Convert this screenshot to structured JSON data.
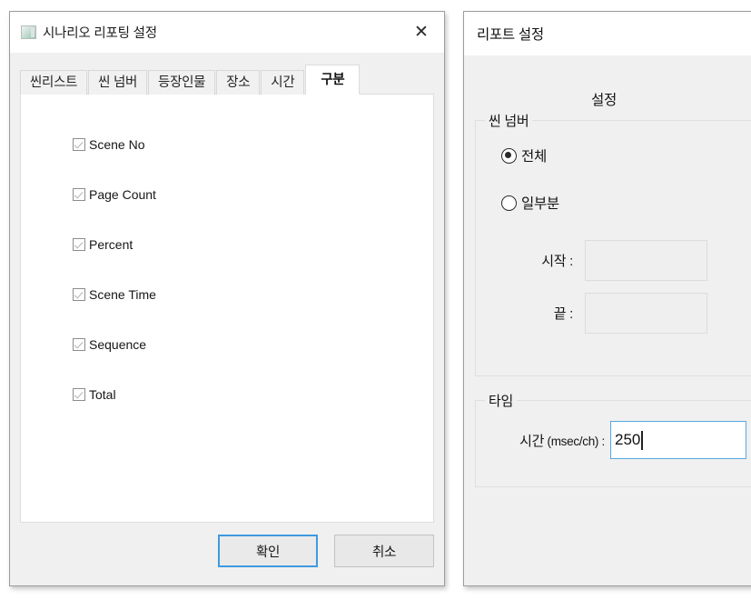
{
  "left_dialog": {
    "title": "시나리오 리포팅 설정",
    "icon": "app-icon",
    "close_label": "✕",
    "tabs": [
      {
        "label": "씬리스트",
        "active": false
      },
      {
        "label": "씬 넘버",
        "active": false
      },
      {
        "label": "등장인물",
        "active": false
      },
      {
        "label": "장소",
        "active": false
      },
      {
        "label": "시간",
        "active": false
      },
      {
        "label": "구분",
        "active": true
      }
    ],
    "checkboxes": [
      {
        "label": "Scene No",
        "checked": true
      },
      {
        "label": "Page Count",
        "checked": true
      },
      {
        "label": "Percent",
        "checked": true
      },
      {
        "label": "Scene Time",
        "checked": true
      },
      {
        "label": "Sequence",
        "checked": true
      },
      {
        "label": "Total",
        "checked": true
      }
    ],
    "buttons": {
      "ok_label": "확인",
      "cancel_label": "취소"
    }
  },
  "right_dialog": {
    "title": "리포트 설정",
    "heading": "설정",
    "scene_number_group": {
      "legend": "씬 넘버",
      "radios": [
        {
          "label": "전체",
          "selected": true
        },
        {
          "label": "일부분",
          "selected": false
        }
      ],
      "fields": [
        {
          "label": "시작 :",
          "value": "",
          "placeholder": ""
        },
        {
          "label": "끝 :",
          "value": "",
          "placeholder": ""
        }
      ]
    },
    "time_group": {
      "legend": "타임",
      "field_label_main": "시간",
      "field_label_unit": " (msec/ch) :",
      "value": "250"
    }
  },
  "colors": {
    "accent": "#3f9ae0",
    "focus_border": "#55a8e2",
    "dialog_bg": "#f0f0f0",
    "panel_bg": "#ffffff"
  }
}
